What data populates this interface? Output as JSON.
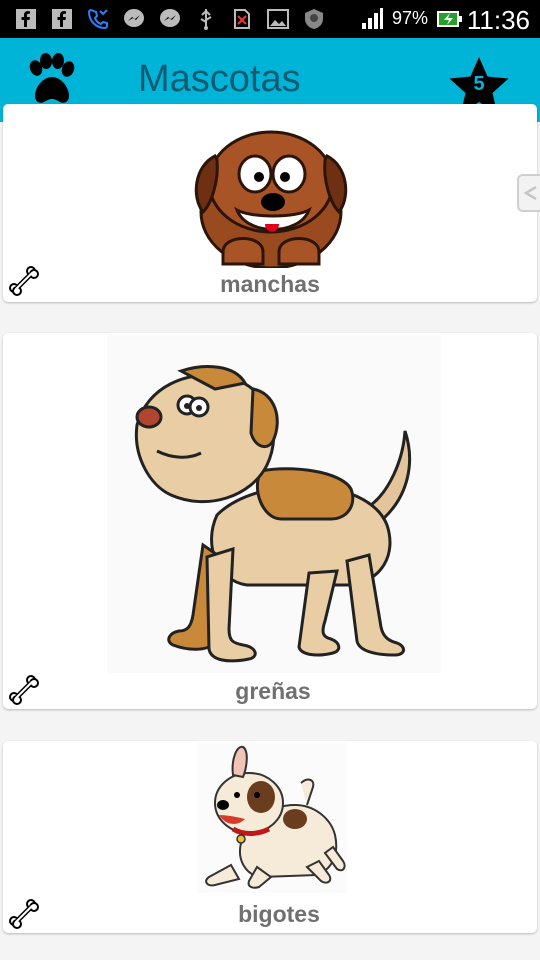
{
  "status_bar": {
    "icons": [
      "facebook-icon",
      "facebook-icon",
      "missed-call-icon",
      "messenger-icon",
      "messenger-icon",
      "usb-icon",
      "no-sim-icon",
      "gallery-icon",
      "shield-icon",
      "signal-icon",
      "battery-charging-icon"
    ],
    "battery": "97%",
    "time": "11:36"
  },
  "app_bar": {
    "title": "Mascotas",
    "star_count": "5",
    "background": "#00b4d8",
    "title_color": "#0f5b73"
  },
  "pets": [
    {
      "name": "manchas"
    },
    {
      "name": "greñas"
    },
    {
      "name": "bigotes"
    }
  ],
  "colors": {
    "name_text": "#707070"
  }
}
